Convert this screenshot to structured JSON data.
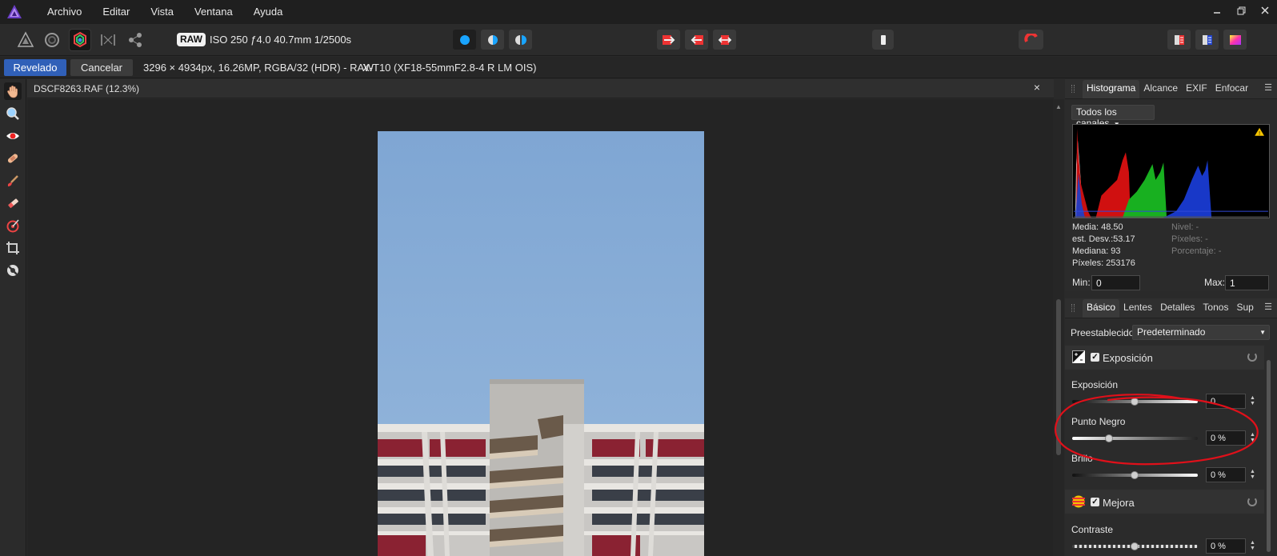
{
  "menu": {
    "items": [
      "Archivo",
      "Editar",
      "Vista",
      "Ventana",
      "Ayuda"
    ]
  },
  "toolbar": {
    "raw_badge": "RAW",
    "exif_summary": "ISO 250 ƒ4.0 40.7mm 1/2500s"
  },
  "context_bar": {
    "develop_label": "Revelado",
    "cancel_label": "Cancelar",
    "image_info": "3296 × 4934px, 16.26MP, RGBA/32 (HDR) - RAW",
    "camera_info": "X-T10 (XF18-55mmF2.8-4 R LM OIS)"
  },
  "document": {
    "tab_title": "DSCF8263.RAF (12.3%)",
    "close_glyph": "×"
  },
  "histogram_panel": {
    "tabs": [
      "Histograma",
      "Alcance",
      "EXIF",
      "Enfocar"
    ],
    "active_tab": "Histograma",
    "channel_select": "Todos los canales",
    "stats_left": [
      "Media: 48.50",
      "est. Desv.:53.17",
      "Mediana: 93",
      "Píxeles: 253176"
    ],
    "stats_right": [
      "Nivel: -",
      "Píxeles: -",
      "Porcentaje: -"
    ],
    "min_label": "Min:",
    "min_value": "0",
    "max_label": "Max:",
    "max_value": "1",
    "warning_glyph": "!"
  },
  "develop_panel": {
    "tabs": [
      "Básico",
      "Lentes",
      "Detalles",
      "Tonos",
      "Sup"
    ],
    "active_tab": "Básico",
    "preset_label": "Preestablecido:",
    "preset_value": "Predeterminado",
    "sections": [
      {
        "title": "Exposición",
        "checked": true,
        "sliders": [
          {
            "label": "Exposición",
            "value": "0",
            "position": 0.5
          },
          {
            "label": "Punto Negro",
            "value": "0 %",
            "position": 0.3
          },
          {
            "label": "Brillo",
            "value": "0 %",
            "position": 0.5
          }
        ]
      },
      {
        "title": "Mejora",
        "checked": true,
        "sliders": [
          {
            "label": "Contraste",
            "value": "0 %",
            "position": 0.5
          }
        ]
      }
    ]
  },
  "colors": {
    "accent": "#3060b8",
    "annotation": "#e0101a",
    "sky": "#8fb1d8"
  }
}
